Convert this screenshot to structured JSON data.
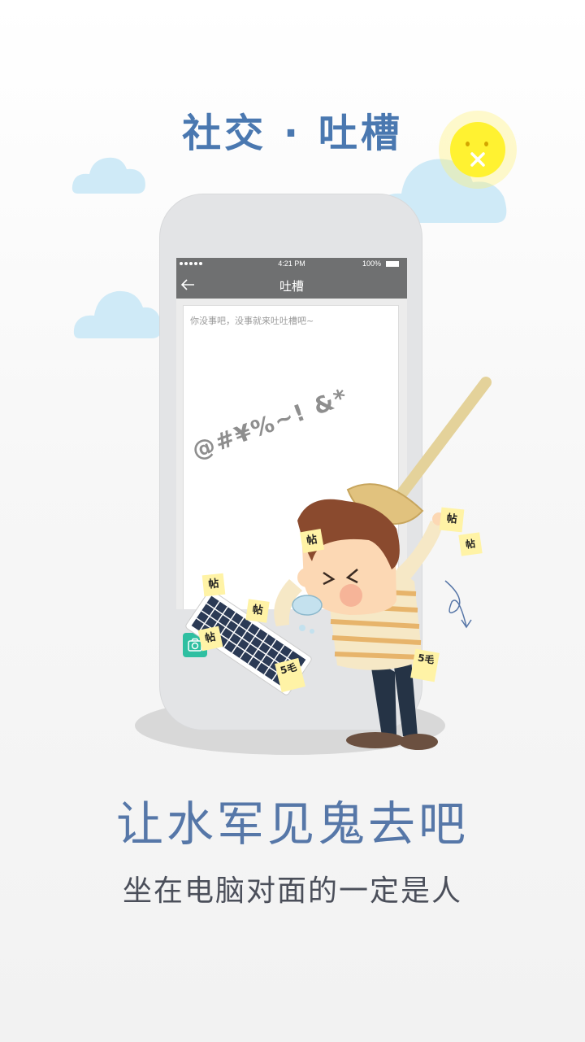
{
  "headline": "社交 · 吐槽",
  "phone": {
    "status": {
      "time": "4:21 PM",
      "battery": "100%"
    },
    "nav_title": "吐槽",
    "placeholder": "你没事吧，没事就来吐吐槽吧~",
    "curse_text": "@#¥%~! &*"
  },
  "stickers": {
    "post_label": "帖",
    "money_label": "5毛"
  },
  "slogan": {
    "title": "让水军见鬼去吧",
    "subtitle": "坐在电脑对面的一定是人"
  },
  "colors": {
    "headline": "#4a78b0",
    "cloud": "#cfeaf7",
    "camera_button": "#2fbfa1",
    "sun": "#fff231"
  }
}
